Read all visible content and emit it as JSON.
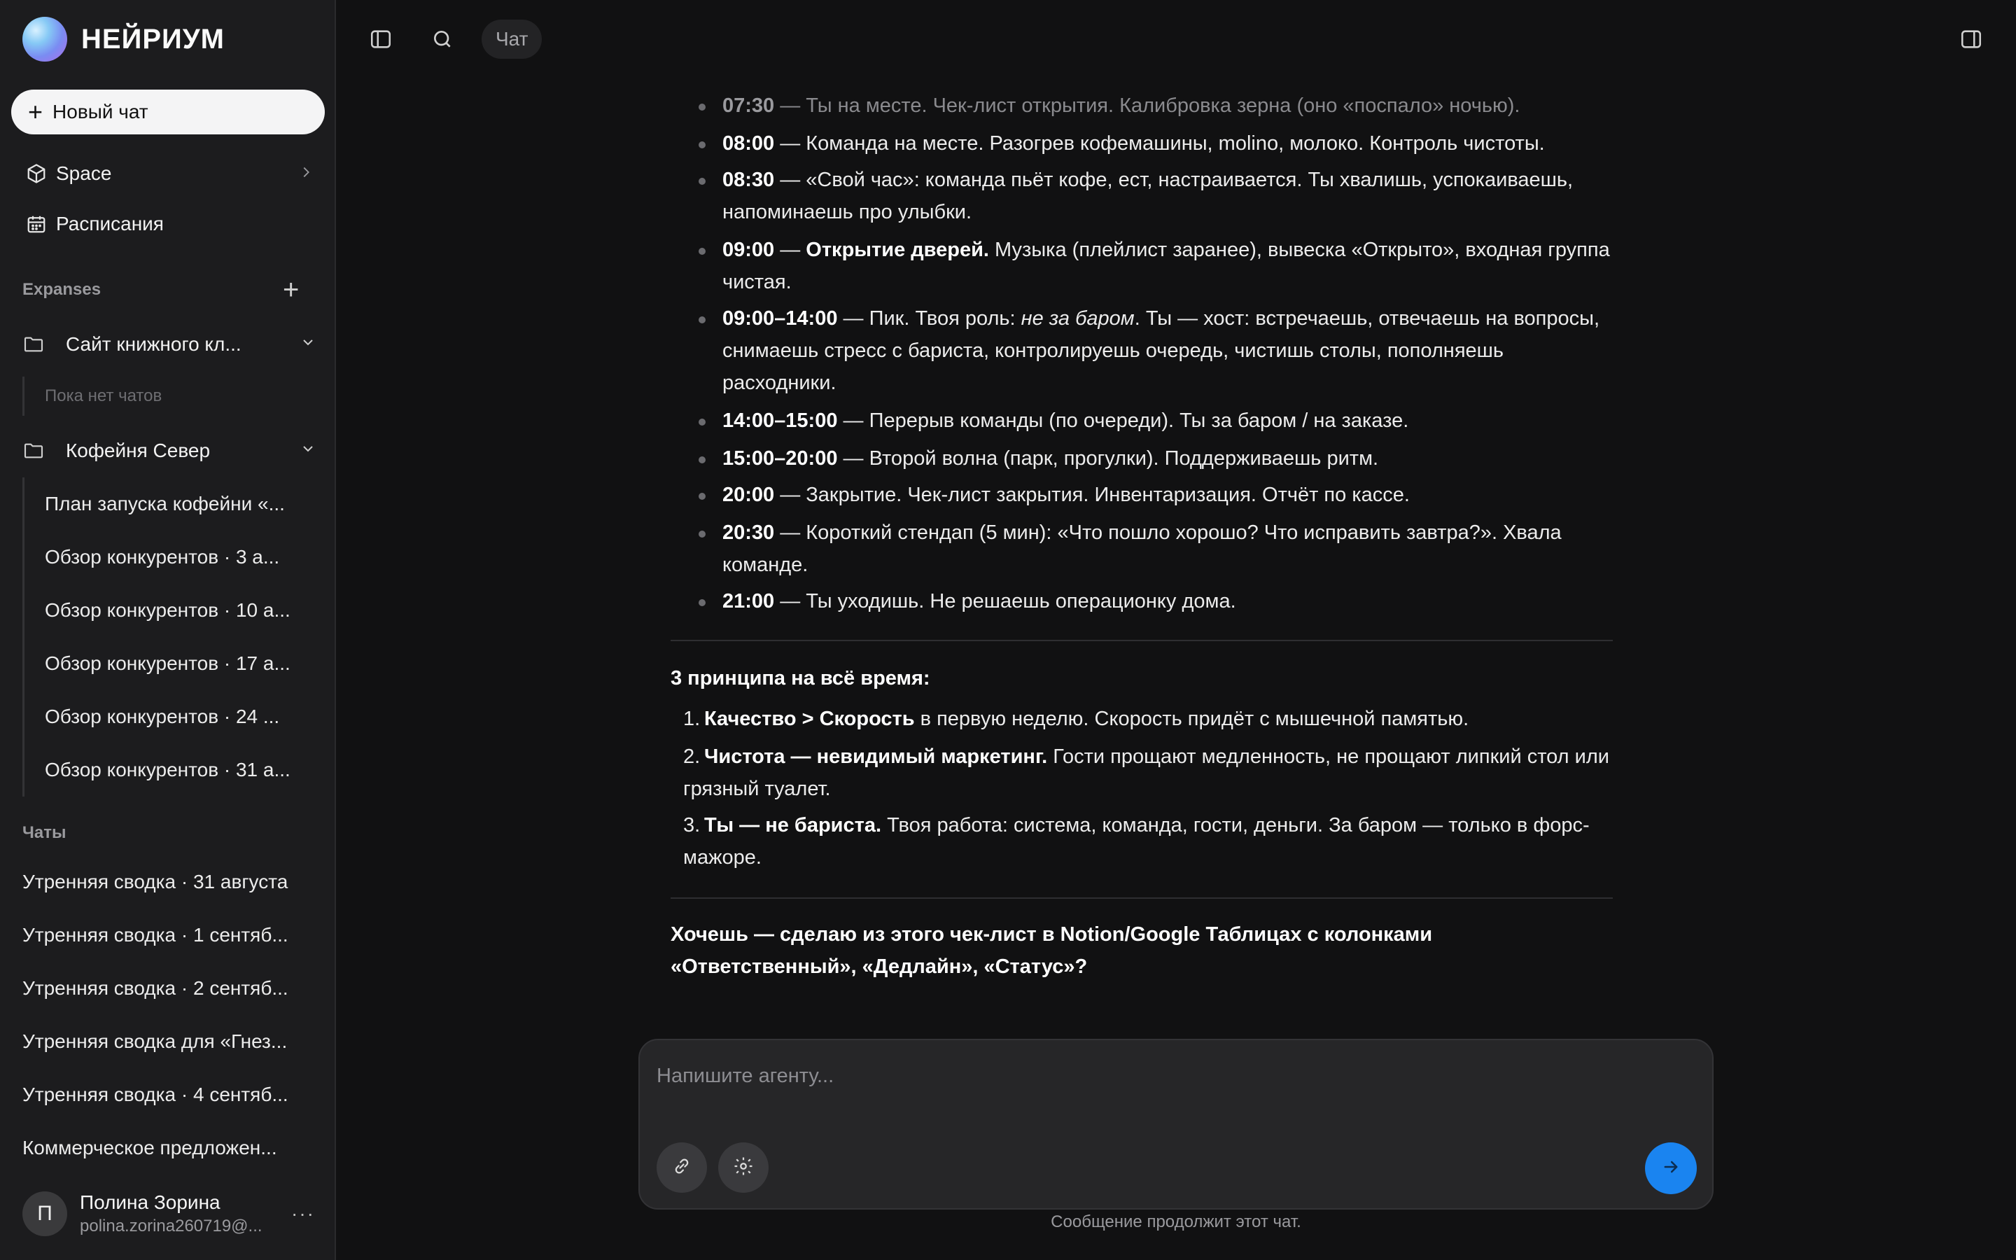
{
  "brand": {
    "name": "НЕЙРИУМ"
  },
  "sidebar": {
    "new_chat_label": "Новый чат",
    "nav": [
      {
        "label": "Space",
        "icon": "cube-icon"
      },
      {
        "label": "Расписания",
        "icon": "calendar-icon"
      }
    ],
    "expanses_label": "Expanses",
    "folders": [
      {
        "label": "Сайт книжного кл...",
        "empty_text": "Пока нет чатов",
        "chats": []
      },
      {
        "label": "Кофейня Север",
        "chats": [
          "План запуска кофейни «...",
          "Обзор конкурентов · 3 а...",
          "Обзор конкурентов · 10 а...",
          "Обзор конкурентов · 17 а...",
          "Обзор конкурентов · 24 ...",
          "Обзор конкурентов · 31 а..."
        ]
      }
    ],
    "chats_label": "Чаты",
    "chats": [
      "Утренняя сводка · 31 августа",
      "Утренняя сводка · 1 сентяб...",
      "Утренняя сводка · 2 сентяб...",
      "Утренняя сводка для «Гнез...",
      "Утренняя сводка · 4 сентяб...",
      "Коммерческое предложен..."
    ],
    "user": {
      "initial": "П",
      "name": "Полина Зорина",
      "email": "polina.zorina260719@..."
    }
  },
  "topbar": {
    "chat_label": "Чат"
  },
  "message": {
    "schedule": [
      {
        "time": "07:30",
        "text": " — Ты на месте. Чек-лист открытия. Калибровка зерна (оно «поспало» ночью)."
      },
      {
        "time": "08:00",
        "text": " — Команда на месте. Разогрев кофемашины, molino, молоко. Контроль чистоты."
      },
      {
        "time": "08:30",
        "text": " — «Свой час»: команда пьёт кофе, ест, настраивается. Ты хвалишь, успокаиваешь, напоминаешь про улыбки."
      },
      {
        "time": "09:00",
        "bold": "Открытие дверей.",
        "text": " Музыка (плейлист заранее), вывеска «Открыто», входная группа чистая."
      },
      {
        "time": "09:00–14:00",
        "text_a": " — Пик. Твоя роль: ",
        "italic": "не за баром",
        "text_b": ". Ты — хост: встречаешь, отвечаешь на вопросы, снимаешь стресс с бариста, контролируешь очередь, чистишь столы, пополняешь расходники."
      },
      {
        "time": "14:00–15:00",
        "text": " — Перерыв команды (по очереди). Ты за баром / на заказе."
      },
      {
        "time": "15:00–20:00",
        "text": " — Второй волна (парк, прогулки). Поддерживаешь ритм."
      },
      {
        "time": "20:00",
        "text": " — Закрытие. Чек-лист закрытия. Инвентаризация. Отчёт по кассе."
      },
      {
        "time": "20:30",
        "text": " — Короткий стендап (5 мин): «Что пошло хорошо? Что исправить завтра?». Хвала команде."
      },
      {
        "time": "21:00",
        "text": " — Ты уходишь. Не решаешь операционку дома."
      }
    ],
    "principles_heading": "3 принципа на всё время:",
    "principles": [
      {
        "num": "1.",
        "bold": "Качество > Скорость",
        "text": " в первую неделю. Скорость придёт с мышечной памятью."
      },
      {
        "num": "2.",
        "bold": "Чистота — невидимый маркетинг.",
        "text": " Гости прощают медленность, не прощают липкий стол или грязный туалет."
      },
      {
        "num": "3.",
        "bold": "Ты — не бариста.",
        "text": " Твоя работа: система, команда, гости, деньги. За баром — только в форс-мажоре."
      }
    ],
    "question": "Хочешь — сделаю из этого чек-лист в Notion/Google Таблицах с колонками «Ответственный», «Дедлайн», «Статус»?"
  },
  "composer": {
    "placeholder": "Напишите агенту...",
    "footer_note": "Сообщение продолжит этот чат."
  },
  "colors": {
    "accent": "#1a84f0",
    "background": "#111112",
    "sidebar": "#1c1c1e"
  }
}
